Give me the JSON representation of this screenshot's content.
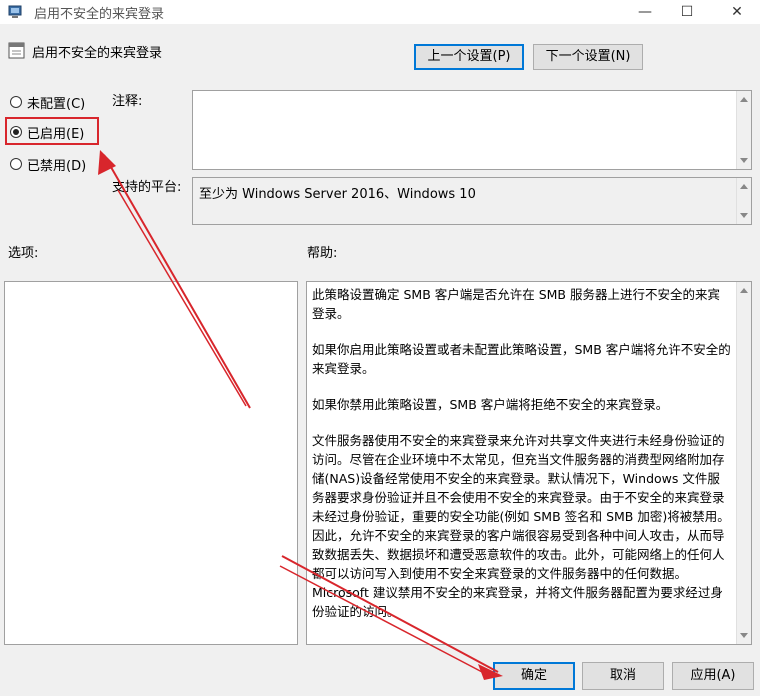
{
  "window": {
    "title": "启用不安全的来宾登录",
    "controls": [
      "—",
      "☐",
      "✕"
    ]
  },
  "policy_heading": "启用不安全的来宾登录",
  "nav": {
    "prev_label": "上一个设置(P)",
    "next_label": "下一个设置(N)"
  },
  "options": [
    {
      "label": "未配置(C)",
      "checked": false
    },
    {
      "label": "已启用(E)",
      "checked": true
    },
    {
      "label": "已禁用(D)",
      "checked": false
    }
  ],
  "labels": {
    "comment": "注释:",
    "platform": "支持的平台:",
    "options": "选项:",
    "help": "帮助:"
  },
  "comment_value": "",
  "platform_value": "至少为 Windows Server 2016、Windows 10",
  "help_paragraphs": [
    "此策略设置确定 SMB 客户端是否允许在 SMB 服务器上进行不安全的来宾登录。",
    "如果你启用此策略设置或者未配置此策略设置，SMB 客户端将允许不安全的来宾登录。",
    "如果你禁用此策略设置，SMB 客户端将拒绝不安全的来宾登录。",
    "文件服务器使用不安全的来宾登录来允许对共享文件夹进行未经身份验证的访问。尽管在企业环境中不太常见，但充当文件服务器的消费型网络附加存储(NAS)设备经常使用不安全的来宾登录。默认情况下，Windows 文件服务器要求身份验证并且不会使用不安全的来宾登录。由于不安全的来宾登录未经过身份验证，重要的安全功能(例如 SMB 签名和 SMB 加密)将被禁用。因此，允许不安全的来宾登录的客户端很容易受到各种中间人攻击，从而导致数据丢失、数据损坏和遭受恶意软件的攻击。此外，可能网络上的任何人都可以访问写入到使用不安全来宾登录的文件服务器中的任何数据。Microsoft 建议禁用不安全的来宾登录，并将文件服务器配置为要求经过身份验证的访问。"
  ],
  "buttons": {
    "ok": "确定",
    "cancel": "取消",
    "apply": "应用(A)"
  },
  "colors": {
    "annotation_red": "#d8262c",
    "focus_blue": "#0078d7"
  }
}
